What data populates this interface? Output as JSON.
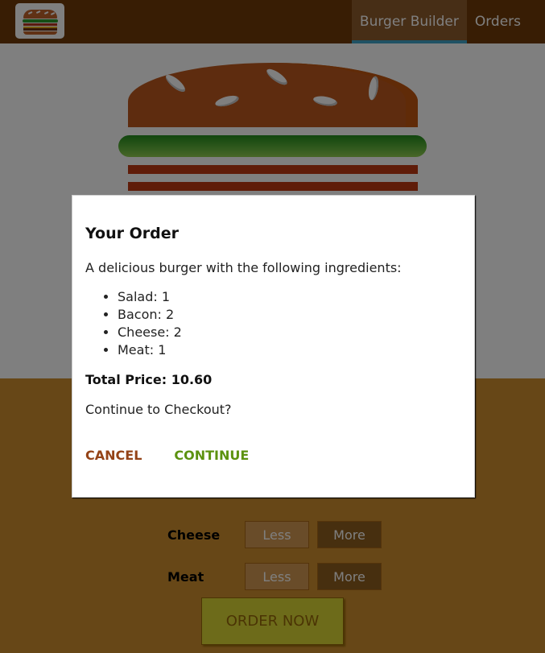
{
  "nav": {
    "items": [
      {
        "label": "Burger Builder",
        "active": true
      },
      {
        "label": "Orders",
        "active": false
      }
    ]
  },
  "controls": [
    {
      "label": "Cheese",
      "less": "Less",
      "more": "More"
    },
    {
      "label": "Meat",
      "less": "Less",
      "more": "More"
    }
  ],
  "order_button": "ORDER NOW",
  "modal": {
    "title": "Your Order",
    "description": "A delicious burger with the following ingredients:",
    "ingredients": [
      "Salad: 1",
      "Bacon: 2",
      "Cheese: 2",
      "Meat: 1"
    ],
    "total_price": "Total Price: 10.60",
    "question": "Continue to Checkout?",
    "cancel": "CANCEL",
    "continue": "CONTINUE"
  },
  "colors": {
    "toolbar": "#703b09",
    "controls_bg": "#cf8f2e",
    "cancel": "#944317",
    "continue": "#5c9210"
  }
}
